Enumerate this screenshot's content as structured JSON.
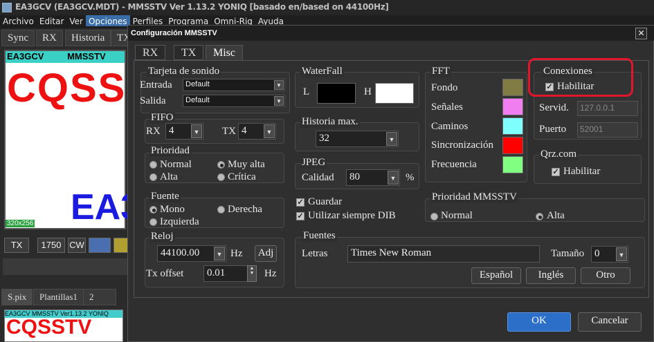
{
  "window": {
    "title": "EA3GCV (EA3GCV.MDT) - MMSSTV Ver 1.13.2 YONIQ [basado en/based on 44100Hz]"
  },
  "menu": [
    "Archivo",
    "Editar",
    "Ver",
    "Opciones",
    "Perfiles",
    "Programa",
    "Omni-Rig",
    "Ayuda"
  ],
  "left_tabs": [
    "Sync",
    "RX",
    "Historia",
    "TX"
  ],
  "preview": {
    "header_left": "EA3GCV",
    "header_right": "MMSSTV",
    "big_text": "CQSS",
    "call_text": "EA3",
    "size": "320x256"
  },
  "left_toolbar": {
    "tx": "TX",
    "freq": "1750",
    "cw": "CW"
  },
  "bottom_tabs": [
    "S.pix",
    "Plantillas1",
    "2"
  ],
  "thumb": {
    "header": "EA3GCV  MMSSTV Ver1.13.2 YONIQ",
    "text": "CQSSTV"
  },
  "dialog": {
    "title": "Configuración MMSSTV",
    "close": "✕",
    "tabs": [
      "RX",
      "TX",
      "Misc"
    ],
    "sound": {
      "title": "Tarjeta de sonido",
      "input_label": "Entrada",
      "input_value": "Default",
      "output_label": "Salida",
      "output_value": "Default"
    },
    "fifo": {
      "title": "FIFO",
      "rx_label": "RX",
      "rx_value": "4",
      "tx_label": "TX",
      "tx_value": "4"
    },
    "priority": {
      "title": "Prioridad",
      "options": [
        "Normal",
        "Muy alta",
        "Alta",
        "Crítica"
      ],
      "selected": "Muy alta"
    },
    "source": {
      "title": "Fuente",
      "options": [
        "Mono",
        "Derecha",
        "Izquierda"
      ],
      "selected": "Mono"
    },
    "clock": {
      "title": "Reloj",
      "value": "44100.00",
      "unit": "Hz",
      "adj": "Adj",
      "tx_offset_label": "Tx offset",
      "tx_offset_value": "0.01",
      "tx_offset_unit": "Hz"
    },
    "waterfall": {
      "title": "WaterFall",
      "l_label": "L",
      "h_label": "H",
      "l_color": "#000000",
      "h_color": "#ffffff"
    },
    "history": {
      "title": "Historia max.",
      "value": "32"
    },
    "jpeg": {
      "title": "JPEG",
      "quality_label": "Calidad",
      "quality_value": "80",
      "unit": "%"
    },
    "save_label": "Guardar",
    "dib_label": "Utilizar siempre DIB",
    "fft": {
      "title": "FFT",
      "items": [
        {
          "label": "Fondo",
          "color": "#807c44"
        },
        {
          "label": "Señales",
          "color": "#f07ef0"
        },
        {
          "label": "Caminos",
          "color": "#80ffff"
        },
        {
          "label": "Sincronización",
          "color": "#ff0000"
        },
        {
          "label": "Frecuencia",
          "color": "#80ff80"
        }
      ]
    },
    "conn": {
      "title": "Conexiones",
      "enable": "Habilitar",
      "server_label": "Servid.",
      "server_value": "127.0.0.1",
      "port_label": "Puerto",
      "port_value": "52001"
    },
    "qrz": {
      "title": "Qrz.com",
      "enable": "Habilitar"
    },
    "mmsstv_priority": {
      "title": "Prioridad MMSSTV",
      "options": [
        "Normal",
        "Alta"
      ],
      "selected": "Alta"
    },
    "fonts": {
      "title": "Fuentes",
      "letters_label": "Letras",
      "letters_value": "Times New Roman",
      "size_label": "Tamaño",
      "size_value": "0",
      "btn_es": "Español",
      "btn_en": "Inglés",
      "btn_other": "Otro"
    },
    "ok": "OK",
    "cancel": "Cancelar"
  }
}
